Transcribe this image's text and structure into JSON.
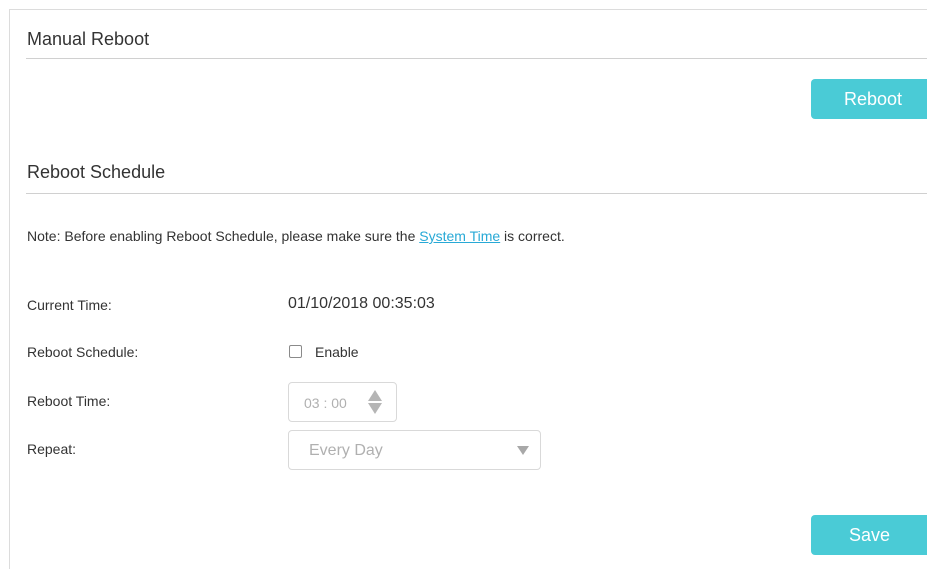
{
  "manual_reboot": {
    "title": "Manual Reboot",
    "reboot_button": "Reboot"
  },
  "reboot_schedule": {
    "title": "Reboot Schedule",
    "note": {
      "prefix": "Note: Before enabling Reboot Schedule, please make sure the ",
      "link": "System Time",
      "suffix": " is correct."
    },
    "fields": {
      "current_time_label": "Current Time:",
      "current_time_value": "01/10/2018 00:35:03",
      "schedule_label": "Reboot Schedule:",
      "enable_label": "Enable",
      "enable_checked": false,
      "reboot_time_label": "Reboot Time:",
      "reboot_time_value": "03 : 00",
      "repeat_label": "Repeat:",
      "repeat_value": "Every Day"
    },
    "save_button": "Save"
  },
  "colors": {
    "accent": "#4acbd6",
    "link": "#28a9d6",
    "disabled_text": "#b0b0b0"
  },
  "icons": {
    "time_spinner": "up-down-arrows-icon",
    "select_caret": "chevron-down-icon"
  }
}
